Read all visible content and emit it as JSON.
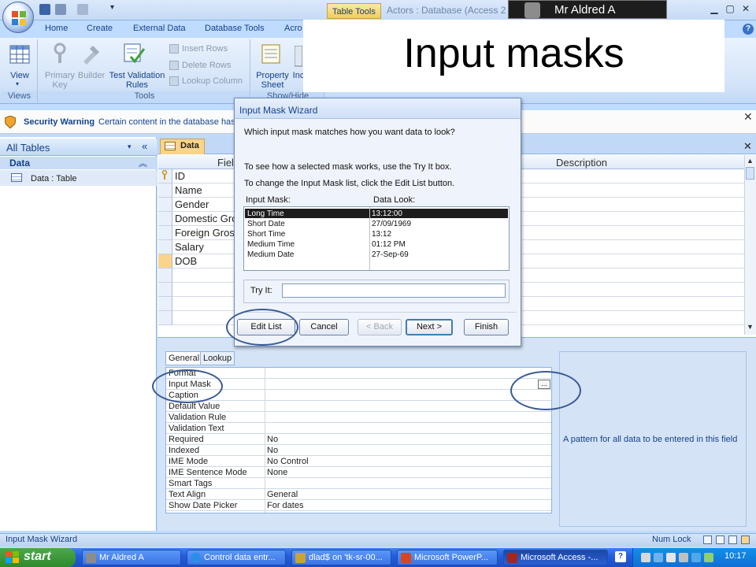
{
  "title_bar": {
    "contextual_tab": "Table Tools",
    "window_title": "Actors : Database (Access 2",
    "user_badge": "Mr Aldred A"
  },
  "ribbon": {
    "tabs": [
      "Home",
      "Create",
      "External Data",
      "Database Tools",
      "Acro"
    ],
    "groups": {
      "views": {
        "label": "Views",
        "view_button": "View"
      },
      "tools": {
        "label": "Tools",
        "primary_key": [
          "Primary",
          "Key"
        ],
        "builder": "Builder",
        "test_validation": [
          "Test Validation",
          "Rules"
        ],
        "insert_rows": "Insert Rows",
        "delete_rows": "Delete Rows",
        "lookup_column": "Lookup Column"
      },
      "show_hide": {
        "label": "Show/Hide",
        "property_sheet": [
          "Property",
          "Sheet"
        ],
        "indexes": "Inc"
      }
    }
  },
  "slide_title": "Input masks",
  "security_warning": {
    "title": "Security Warning",
    "text": "Certain content in the database has"
  },
  "nav_pane": {
    "title": "All Tables",
    "group": "Data",
    "items": [
      {
        "label": "Data : Table"
      }
    ]
  },
  "document": {
    "tab_label": "Data",
    "columns": [
      "Fiel",
      "Description"
    ],
    "fields": [
      "ID",
      "Name",
      "Gender",
      "Domestic Gro",
      "Foreign Gross",
      "Salary",
      "DOB"
    ]
  },
  "field_properties": {
    "tabs": [
      "General",
      "Lookup"
    ],
    "rows": [
      {
        "label": "Format",
        "value": ""
      },
      {
        "label": "Input Mask",
        "value": ""
      },
      {
        "label": "Caption",
        "value": ""
      },
      {
        "label": "Default Value",
        "value": ""
      },
      {
        "label": "Validation Rule",
        "value": ""
      },
      {
        "label": "Validation Text",
        "value": ""
      },
      {
        "label": "Required",
        "value": "No"
      },
      {
        "label": "Indexed",
        "value": "No"
      },
      {
        "label": "IME Mode",
        "value": "No Control"
      },
      {
        "label": "IME Sentence Mode",
        "value": "None"
      },
      {
        "label": "Smart Tags",
        "value": ""
      },
      {
        "label": "Text Align",
        "value": "General"
      },
      {
        "label": "Show Date Picker",
        "value": "For dates"
      }
    ],
    "builder_button": "...",
    "help_text": "A pattern for all data to be entered in this field"
  },
  "wizard": {
    "title": "Input Mask Wizard",
    "question": "Which input mask matches how you want data to look?",
    "instruction1": "To see how a selected mask works, use the Try It box.",
    "instruction2": "To change the Input Mask list, click the Edit List button.",
    "col_mask": "Input Mask:",
    "col_look": "Data Look:",
    "masks": [
      {
        "name": "Long Time",
        "look": "13:12:00",
        "selected": true
      },
      {
        "name": "Short Date",
        "look": "27/09/1969"
      },
      {
        "name": "Short Time",
        "look": "13:12"
      },
      {
        "name": "Medium Time",
        "look": "01:12 PM"
      },
      {
        "name": "Medium Date",
        "look": "27-Sep-69"
      }
    ],
    "try_it_label": "Try It:",
    "try_it_value": "",
    "buttons": {
      "edit_list": "Edit List",
      "cancel": "Cancel",
      "back": "< Back",
      "next": "Next >",
      "finish": "Finish"
    }
  },
  "status_bar": {
    "left": "Input Mask Wizard",
    "num_lock": "Num Lock"
  },
  "taskbar": {
    "start": "start",
    "tasks": [
      {
        "label": "Mr Aldred A"
      },
      {
        "label": "Control data entr..."
      },
      {
        "label": "dlad$ on 'tk-sr-00..."
      },
      {
        "label": "Microsoft PowerP..."
      },
      {
        "label": "Microsoft Access -..."
      }
    ],
    "clock": "10:17"
  },
  "colors": {
    "ribbon_blue": "#bfdbff",
    "accent_text": "#15428b",
    "highlight_orange": "#fbd48b",
    "callout_oval": "#3a5a95"
  }
}
